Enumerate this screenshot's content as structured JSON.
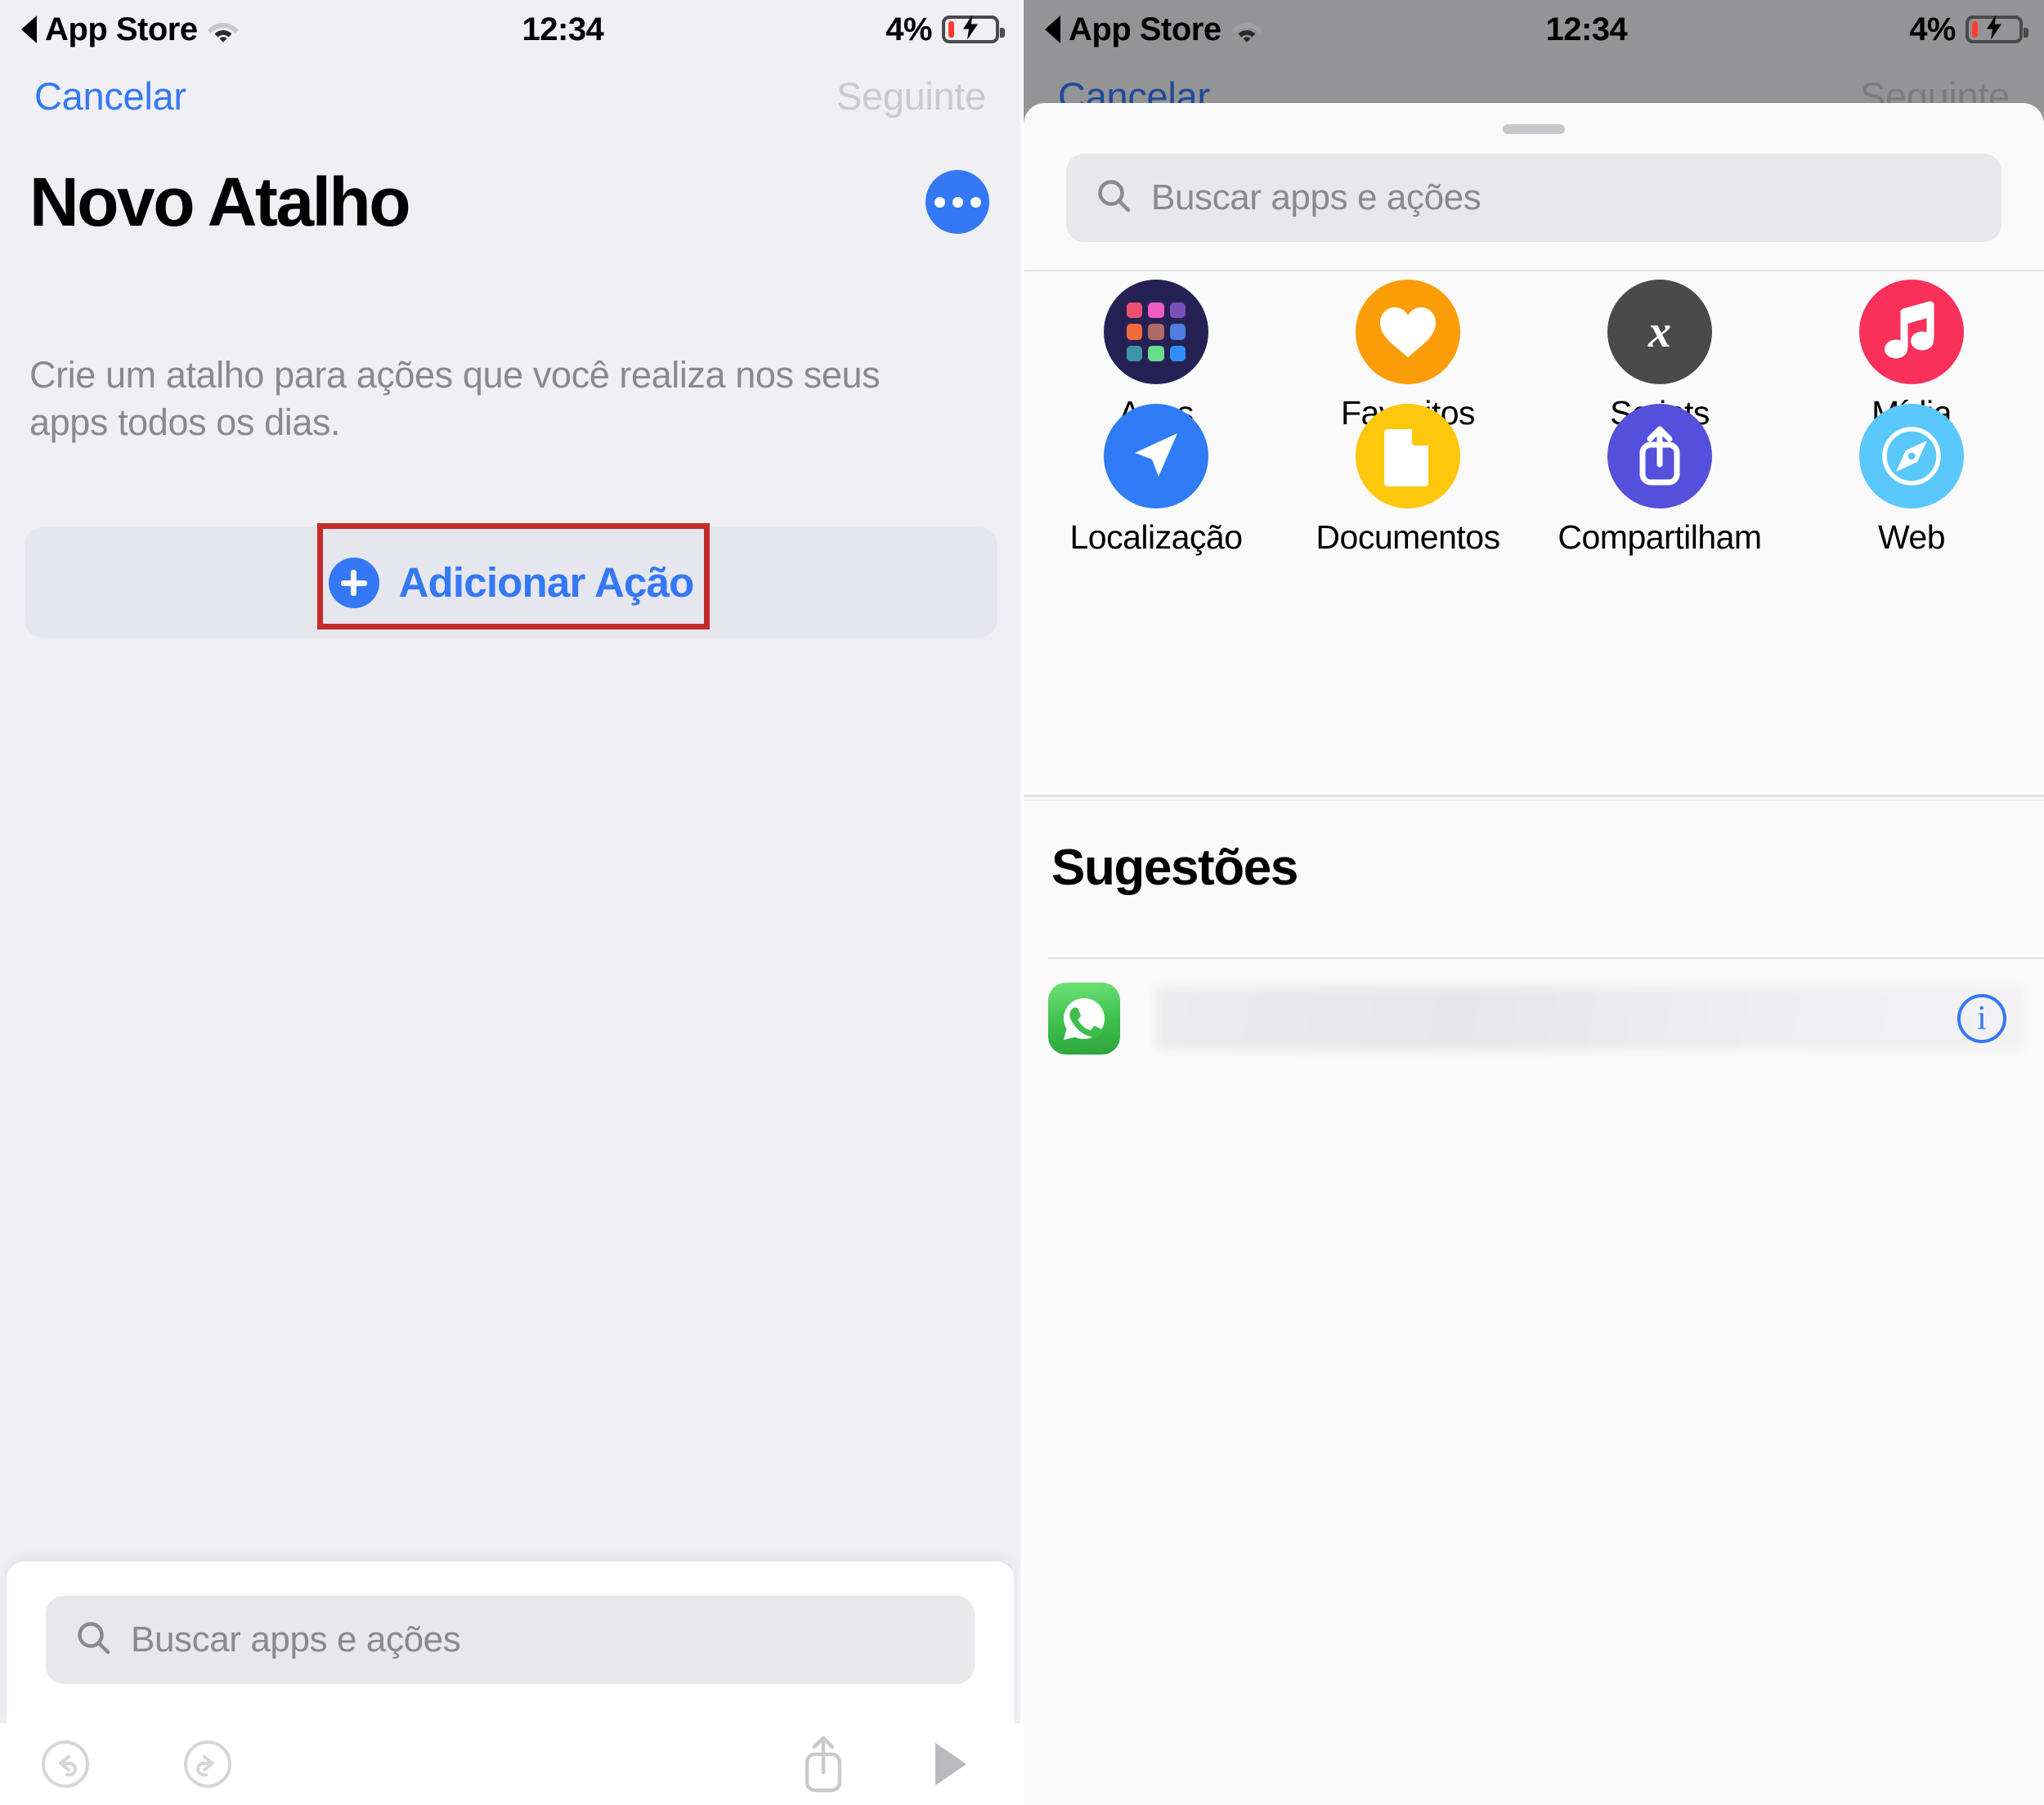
{
  "status_bar": {
    "back_label": "App Store",
    "wifi_icon": "wifi-icon",
    "time": "12:34",
    "battery_percent": "4%",
    "battery_icon": "battery-charging-icon"
  },
  "left_screen": {
    "nav": {
      "cancel_label": "Cancelar",
      "next_label": "Seguinte"
    },
    "title": "Novo Atalho",
    "more_button_icon": "ellipsis-icon",
    "subtitle": "Crie um atalho para ações que você realiza nos seus apps todos os dias.",
    "add_action": {
      "label": "Adicionar Ação",
      "icon": "plus-circle-icon",
      "highlight_color": "#C42B2B"
    },
    "search": {
      "placeholder": "Buscar apps e ações",
      "icon": "search-icon",
      "value": ""
    },
    "toolbar": {
      "undo_icon": "undo-icon",
      "redo_icon": "redo-icon",
      "share_icon": "share-icon",
      "play_icon": "play-icon"
    }
  },
  "right_screen": {
    "backdrop_nav": {
      "cancel_label": "Cancelar",
      "next_label": "Seguinte"
    },
    "sheet": {
      "grabber_icon": "grabber-handle",
      "search": {
        "placeholder": "Buscar apps e ações",
        "icon": "search-icon",
        "value": ""
      },
      "categories": [
        {
          "label": "Apps",
          "icon": "apps-grid-icon",
          "color": "#262154"
        },
        {
          "label": "Favoritos",
          "icon": "heart-icon",
          "color": "#FB9D09"
        },
        {
          "label": "Scripts",
          "icon": "script-x-icon",
          "color": "#4A4A4A",
          "highlighted": true,
          "highlight_color": "#C42B2B"
        },
        {
          "label": "Mídia",
          "icon": "music-note-icon",
          "color": "#F8305A"
        },
        {
          "label": "Localização",
          "icon": "navigation-arrow-icon",
          "color": "#2F7CF6"
        },
        {
          "label": "Documentos",
          "icon": "document-icon",
          "color": "#FDC70B"
        },
        {
          "label": "Compartilham",
          "icon": "share-icon",
          "color": "#5450DB"
        },
        {
          "label": "Web",
          "icon": "safari-compass-icon",
          "color": "#5AC8FA"
        }
      ],
      "apps_icon_tile_colors": [
        "#F05070",
        "#F05CC0",
        "#7B4FB8",
        "#F06A3C",
        "#B06A6A",
        "#4D7EE0",
        "#3F94A6",
        "#6BDC8A",
        "#2F8FF6"
      ],
      "suggestions": {
        "title": "Sugestões",
        "items": [
          {
            "app_icon": "whatsapp-icon",
            "label": "",
            "label_redacted": true,
            "info_icon": "info-circle-icon"
          }
        ]
      }
    }
  }
}
